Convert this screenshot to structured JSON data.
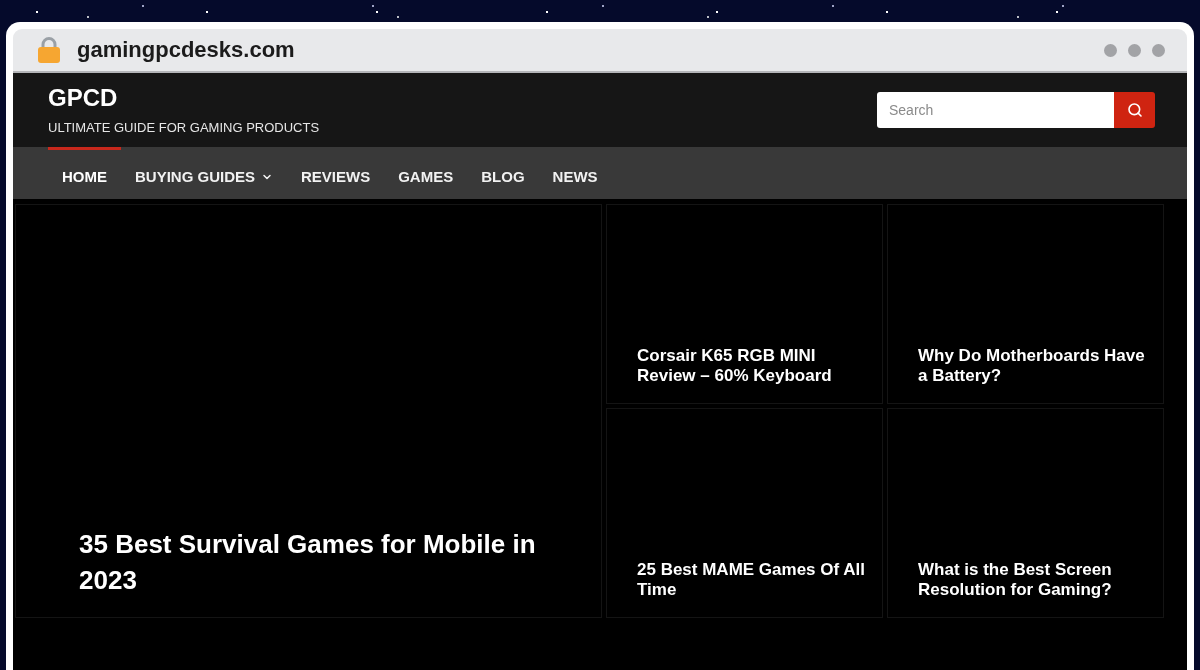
{
  "browser": {
    "url": "gamingpcdesks.com"
  },
  "site": {
    "title": "GPCD",
    "tagline": "ULTIMATE GUIDE FOR GAMING PRODUCTS"
  },
  "search": {
    "placeholder": "Search"
  },
  "nav": [
    {
      "label": "HOME",
      "selected": true,
      "dropdown": false
    },
    {
      "label": "BUYING GUIDES",
      "selected": false,
      "dropdown": true
    },
    {
      "label": "REVIEWS",
      "selected": false,
      "dropdown": false
    },
    {
      "label": "GAMES",
      "selected": false,
      "dropdown": false
    },
    {
      "label": "BLOG",
      "selected": false,
      "dropdown": false
    },
    {
      "label": "NEWS",
      "selected": false,
      "dropdown": false
    }
  ],
  "featured": {
    "title": "35 Best Survival Games for Mobile in 2023"
  },
  "posts": [
    {
      "title": "Corsair K65 RGB MINI Review – 60% Keyboard"
    },
    {
      "title": "Why Do Motherboards Have a Battery?"
    },
    {
      "title": "25 Best MAME Games Of All Time"
    },
    {
      "title": "What is the Best Screen Resolution for Gaming?"
    }
  ]
}
